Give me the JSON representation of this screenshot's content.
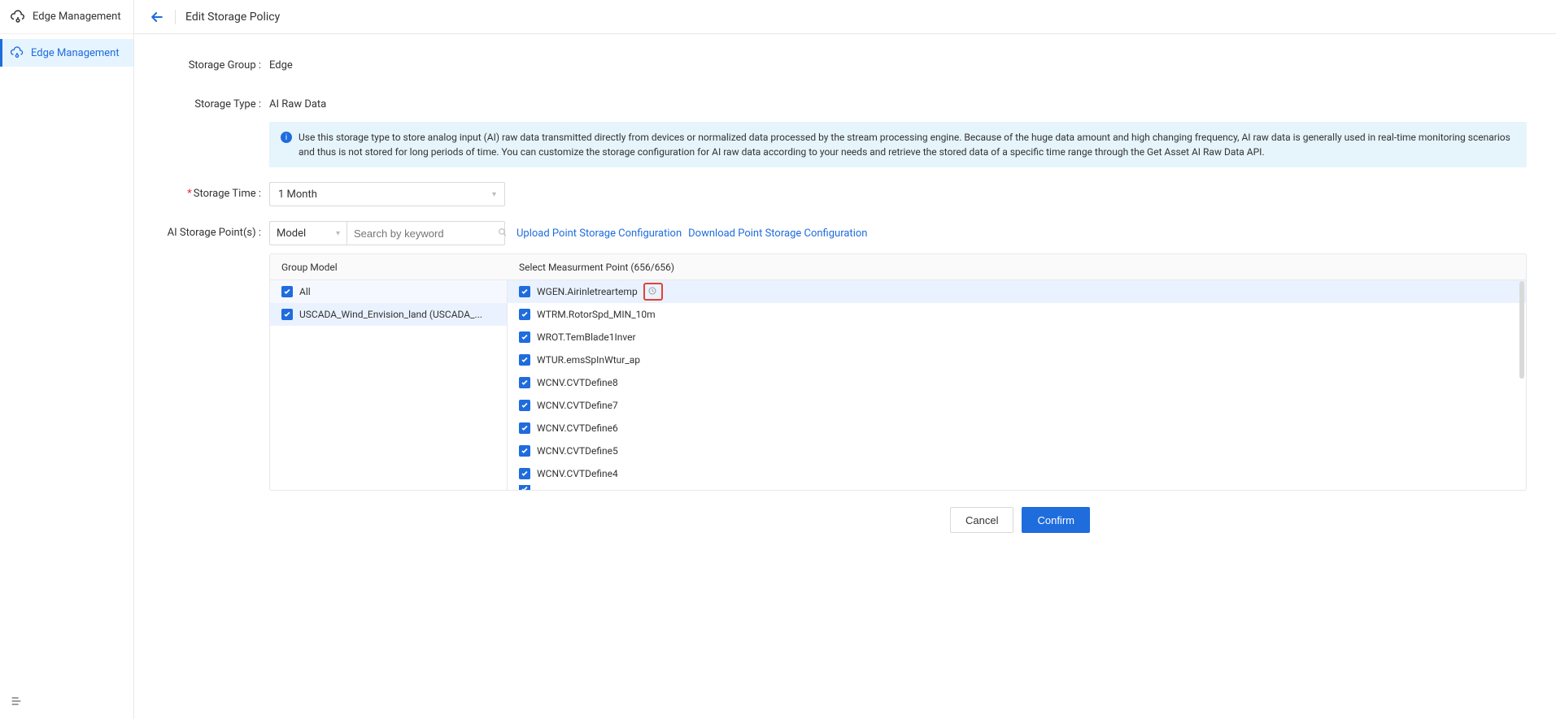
{
  "sidebar": {
    "title": "Edge Management",
    "items": [
      {
        "label": "Edge Management",
        "active": true
      }
    ]
  },
  "topbar": {
    "title": "Edit Storage Policy"
  },
  "form": {
    "storage_group_label": "Storage Group :",
    "storage_group_value": "Edge",
    "storage_type_label": "Storage Type :",
    "storage_type_value": "AI Raw Data",
    "info_text": "Use this storage type to store analog input (AI) raw data transmitted directly from devices or normalized data processed by the stream processing engine. Because of the huge data amount and high changing frequency, AI raw data is generally used in real-time monitoring scenarios and thus is not stored for long periods of time. You can customize the storage configuration for AI raw data according to your needs and retrieve the stored data of a specific time range through the Get Asset AI Raw Data API.",
    "storage_time_label": "Storage Time :",
    "storage_time_value": "1 Month",
    "ai_storage_points_label": "AI Storage Point(s) :",
    "model_select_value": "Model",
    "search_placeholder": "Search by keyword",
    "upload_link": "Upload Point Storage Configuration",
    "download_link": "Download Point Storage Configuration"
  },
  "table": {
    "group_header": "Group Model",
    "measure_header": "Select Measurment Point (656/656)",
    "groups": [
      {
        "label": "All",
        "checked": true
      },
      {
        "label": "USCADA_Wind_Envision_land (USCADA_...",
        "checked": true
      }
    ],
    "measurements": [
      {
        "label": "WGEN.Airinletreartemp",
        "checked": true,
        "has_clock": true
      },
      {
        "label": "WTRM.RotorSpd_MIN_10m",
        "checked": true
      },
      {
        "label": "WROT.TemBlade1Inver",
        "checked": true
      },
      {
        "label": "WTUR.emsSpInWtur_ap",
        "checked": true
      },
      {
        "label": "WCNV.CVTDefine8",
        "checked": true
      },
      {
        "label": "WCNV.CVTDefine7",
        "checked": true
      },
      {
        "label": "WCNV.CVTDefine6",
        "checked": true
      },
      {
        "label": "WCNV.CVTDefine5",
        "checked": true
      },
      {
        "label": "WCNV.CVTDefine4",
        "checked": true
      }
    ]
  },
  "footer": {
    "cancel": "Cancel",
    "confirm": "Confirm"
  }
}
